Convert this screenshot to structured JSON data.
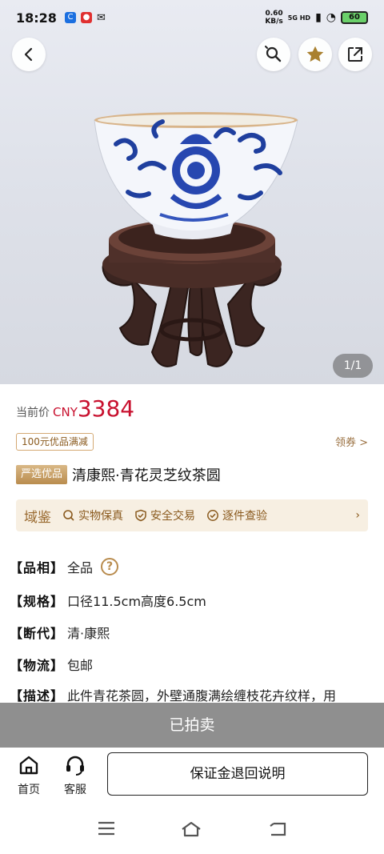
{
  "status_bar": {
    "time": "18:28",
    "speed_value": "0.60",
    "speed_unit": "KB/s",
    "network": "5G HD",
    "battery": "60"
  },
  "header": {
    "back_icon": "chevron-left-icon",
    "search_icon": "search-icon",
    "favorite_icon": "star-icon",
    "share_icon": "share-icon"
  },
  "gallery": {
    "counter": "1/1"
  },
  "price": {
    "label": "当前价",
    "currency": "CNY",
    "value": "3384"
  },
  "coupon": {
    "tag": "100元优品满减",
    "link": "领券 >"
  },
  "product": {
    "badge": "严选优品",
    "title": "清康熙·青花灵芝纹茶圆"
  },
  "assurance": {
    "brand": "域鉴",
    "items": [
      "实物保真",
      "安全交易",
      "逐件查验"
    ]
  },
  "attributes": [
    {
      "key": "【品相】",
      "value": "全品"
    },
    {
      "key": "【规格】",
      "value": "口径11.5cm高度6.5cm"
    },
    {
      "key": "【断代】",
      "value": "清·康熙"
    },
    {
      "key": "【物流】",
      "value": "包邮"
    },
    {
      "key": "【描述】",
      "value": "此件青花茶圆，外壁通腹满绘缠枝花卉纹样，用"
    }
  ],
  "status_banner": "已拍卖",
  "bottom_nav": {
    "home": "首页",
    "service": "客服",
    "deposit_button": "保证金退回说明"
  },
  "colors": {
    "price": "#c8102e",
    "gold": "#b98c4e",
    "sold_bar": "#8f8f8f"
  }
}
